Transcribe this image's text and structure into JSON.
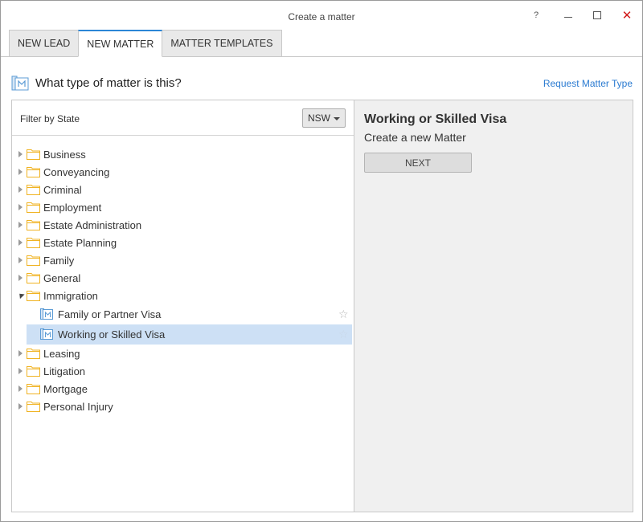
{
  "window": {
    "title": "Create a matter",
    "help_label": "?",
    "close_label": "✕"
  },
  "tabs": [
    {
      "label": "NEW LEAD",
      "active": false
    },
    {
      "label": "NEW MATTER",
      "active": true
    },
    {
      "label": "MATTER TEMPLATES",
      "active": false
    }
  ],
  "header": {
    "question": "What type of matter is this?",
    "request_link": "Request Matter Type"
  },
  "filter": {
    "label": "Filter by State",
    "state_value": "NSW"
  },
  "tree": {
    "before": [
      "Business",
      "Conveyancing",
      "Criminal",
      "Employment",
      "Estate Administration",
      "Estate Planning",
      "Family",
      "General"
    ],
    "expanded": "Immigration",
    "children": [
      "Family or Partner Visa",
      "Working or Skilled Visa"
    ],
    "after": [
      "Leasing",
      "Litigation",
      "Mortgage",
      "Personal Injury"
    ],
    "star_glyph": "☆"
  },
  "detail": {
    "title": "Working or Skilled Visa",
    "subtitle": "Create a new Matter",
    "next_label": "NEXT"
  },
  "colors": {
    "accent": "#2b86d6",
    "folder": "#f0b323",
    "selection": "#cde0f5",
    "link": "#2b7bd1",
    "close": "#d11a1a"
  }
}
